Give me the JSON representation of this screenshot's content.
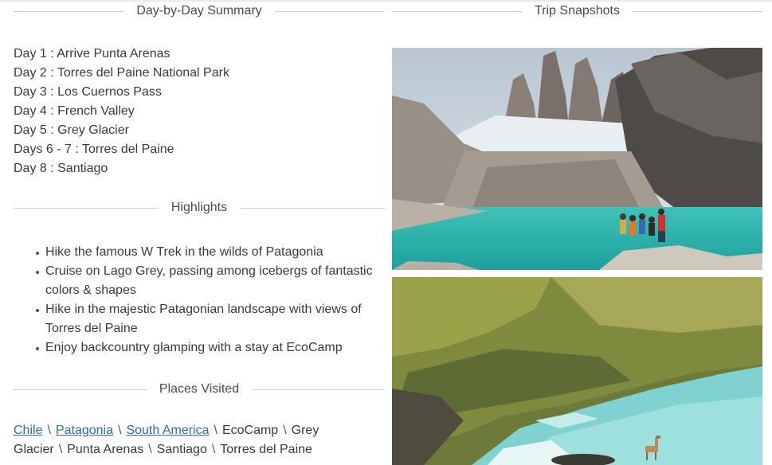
{
  "summary": {
    "heading": "Day-by-Day Summary",
    "days": [
      "Day 1 : Arrive Punta Arenas",
      "Day 2 : Torres del Paine National Park",
      "Day 3 : Los Cuernos Pass",
      "Day 4 : French Valley",
      "Day 5 : Grey Glacier",
      "Days 6 - 7 : Torres del Paine",
      "Day 8 : Santiago"
    ]
  },
  "highlights": {
    "heading": "Highlights",
    "items": [
      "Hike the famous W Trek in the wilds of Patagonia",
      "Cruise on Lago Grey, passing among icebergs of fantastic colors & shapes",
      "Hike in the majestic Patagonian landscape with views of Torres del Paine",
      "Enjoy backcountry glamping with a stay at EcoCamp"
    ]
  },
  "places": {
    "heading": "Places Visited",
    "links": [
      "Chile",
      "Patagonia",
      "South America"
    ],
    "plain": [
      "EcoCamp",
      "Grey Glacier",
      "Punta Arenas",
      "Santiago",
      "Torres del Paine"
    ],
    "separator": "\\"
  },
  "snapshots": {
    "heading": "Trip Snapshots"
  },
  "colors": {
    "link": "#2a6db0",
    "divider": "#cfcfcf",
    "text": "#3a3a3a",
    "lagoon": "#2fb7b0",
    "river": "#7fd2d0"
  }
}
